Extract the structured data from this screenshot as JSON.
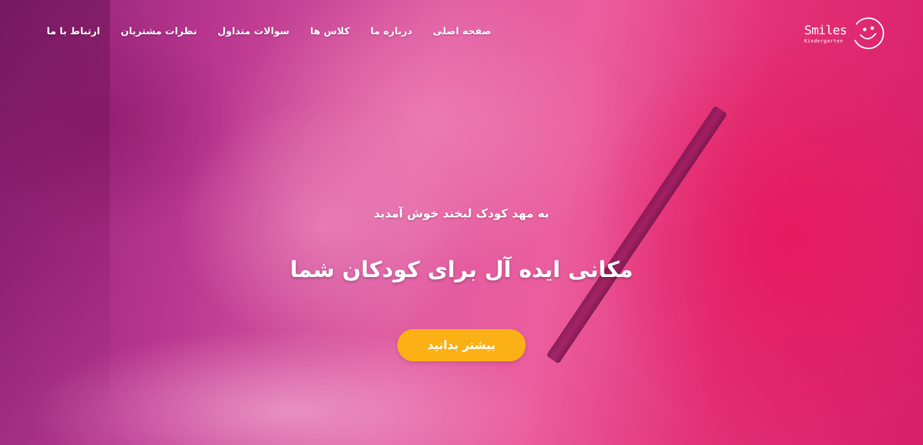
{
  "brand": {
    "name": "Smiles",
    "tagline": "Kindergarten",
    "logo_icon": "smiley-face-icon"
  },
  "nav": {
    "items": [
      {
        "label": "صفحه اصلی"
      },
      {
        "label": "درباره ما"
      },
      {
        "label": "کلاس ها"
      },
      {
        "label": "سوالات متداول"
      },
      {
        "label": "نظرات مشتریان"
      },
      {
        "label": "ارتباط با ما"
      }
    ]
  },
  "hero": {
    "welcome": "به مهد کودک لبخند خوش آمدید",
    "headline": "مکانی ایده آل برای کودکان شما",
    "cta_label": "بیشتر بدانید"
  },
  "colors": {
    "accent": "#fbb116",
    "overlay": "#e0449a",
    "text": "#ffffff"
  }
}
